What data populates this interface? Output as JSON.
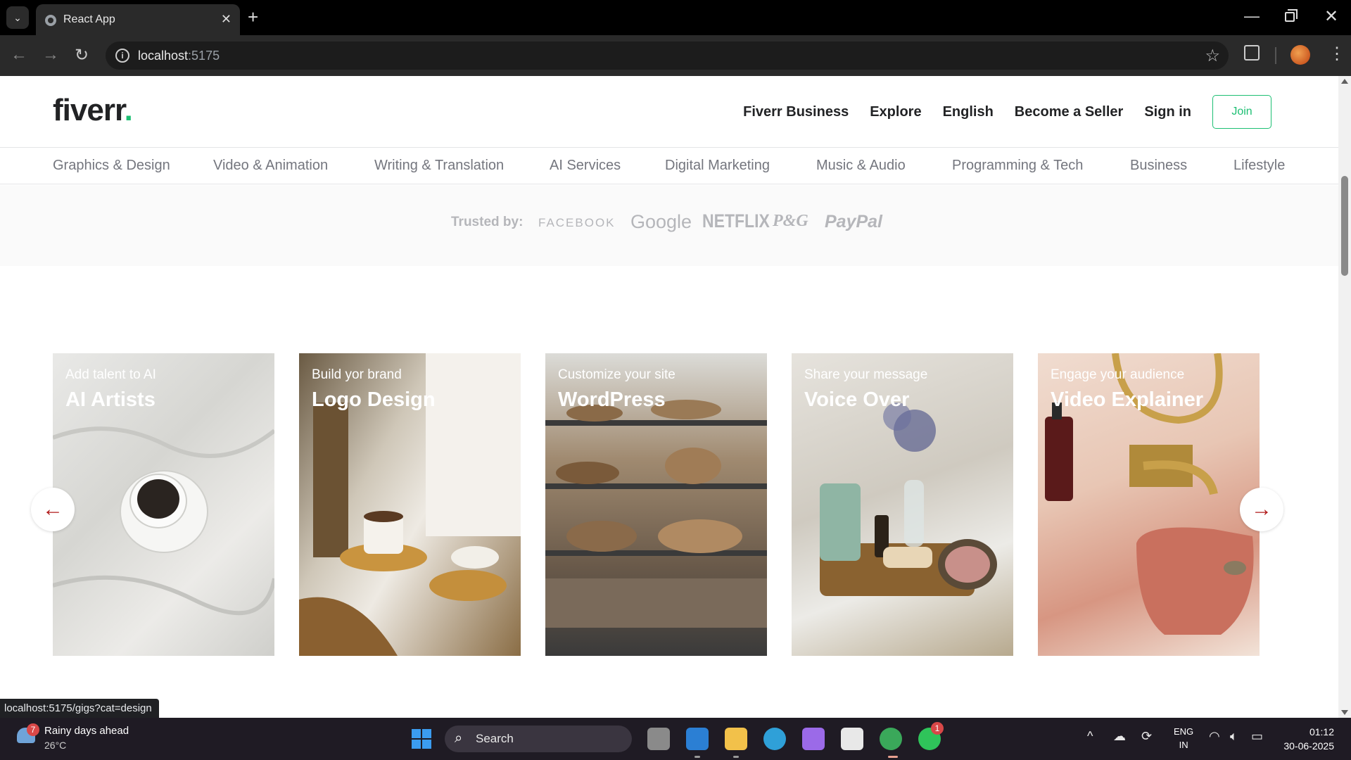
{
  "browser": {
    "tab_title": "React App",
    "url_host": "localhost",
    "url_port": ":5175"
  },
  "header": {
    "logo": "fiverr",
    "logo_dot": ".",
    "nav": [
      "Fiverr Business",
      "Explore",
      "English",
      "Become a Seller",
      "Sign in"
    ],
    "join_label": "Join"
  },
  "categories": [
    "Graphics & Design",
    "Video & Animation",
    "Writing & Translation",
    "AI Services",
    "Digital Marketing",
    "Music & Audio",
    "Programming & Tech",
    "Business",
    "Lifestyle"
  ],
  "trusted": {
    "label": "Trusted by:",
    "brands": [
      "FACEBOOK",
      "Google",
      "NETFLIX",
      "P&G",
      "PayPal"
    ]
  },
  "slider": {
    "cards": [
      {
        "subtitle": "Add talent to AI",
        "title": "AI Artists"
      },
      {
        "subtitle": "Build yor brand",
        "title": "Logo Design"
      },
      {
        "subtitle": "Customize your site",
        "title": "WordPress"
      },
      {
        "subtitle": "Share your message",
        "title": "Voice Over"
      },
      {
        "subtitle": "Engage your audience",
        "title": "Video Explainer"
      }
    ],
    "prev_icon": "arrow-left-icon",
    "next_icon": "arrow-right-icon"
  },
  "status_url": "localhost:5175/gigs?cat=design",
  "taskbar": {
    "weather_badge": "7",
    "weather_text": "Rainy days ahead",
    "weather_temp": "26°C",
    "search_label": "Search",
    "lang_top": "ENG",
    "lang_bottom": "IN",
    "time": "01:12",
    "date": "30-06-2025",
    "whatsapp_badge": "1"
  }
}
